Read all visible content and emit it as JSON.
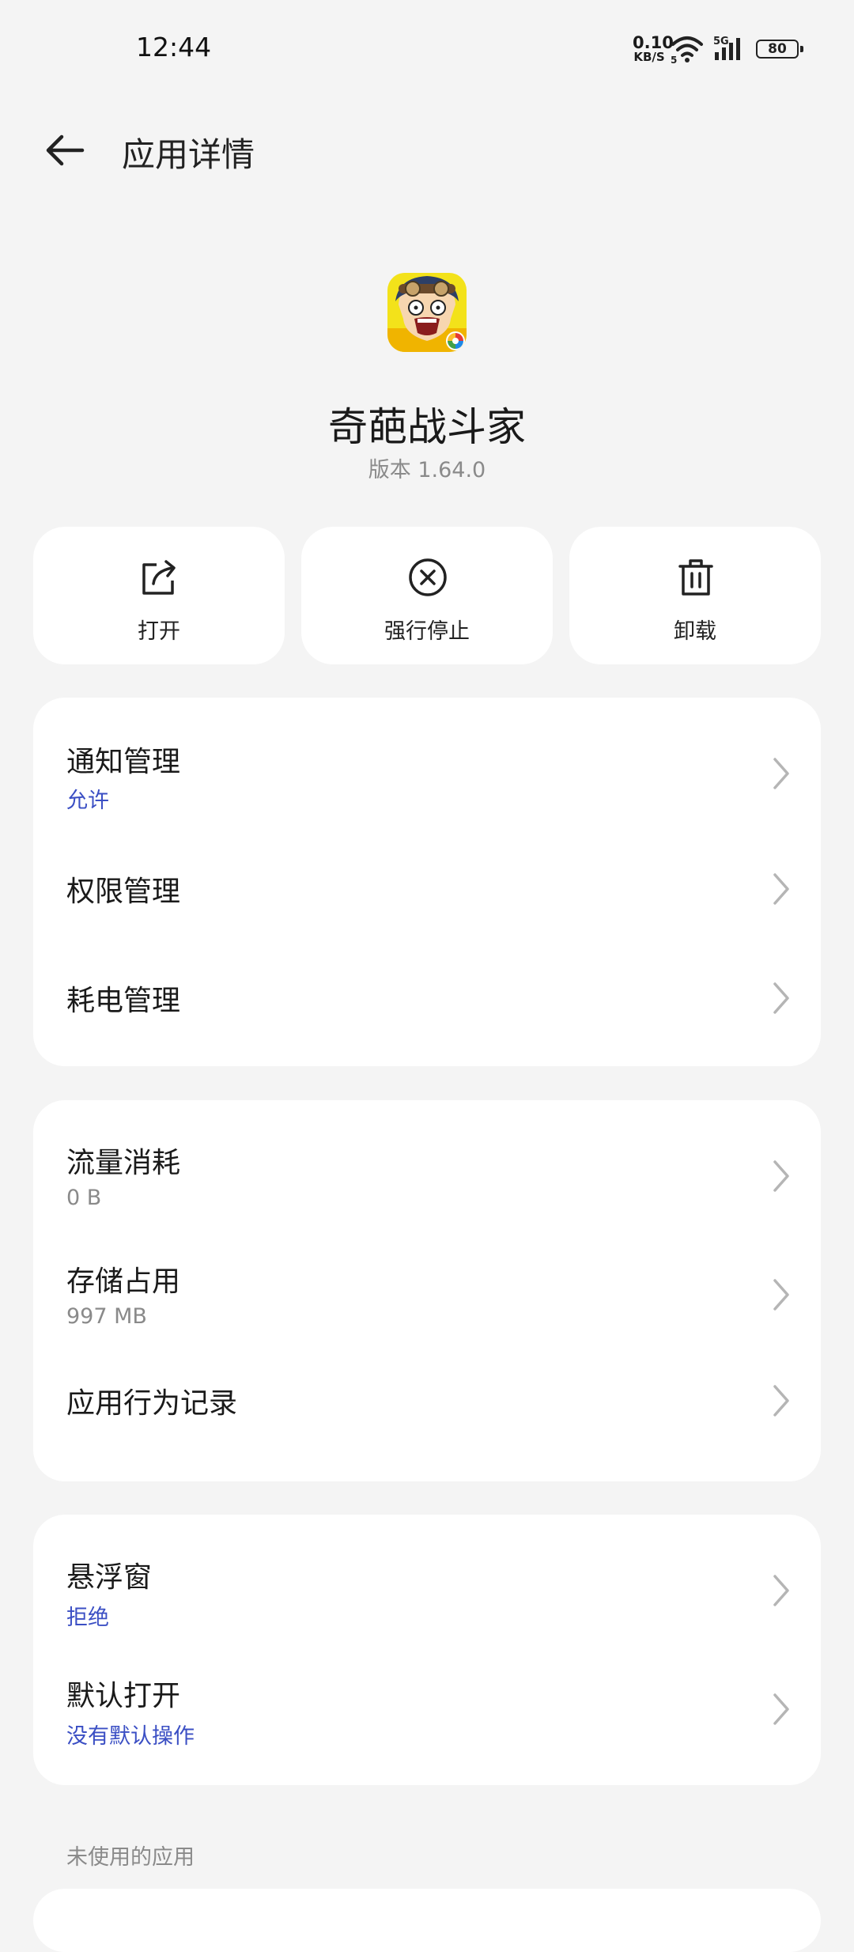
{
  "status_bar": {
    "time": "12:44",
    "net_speed_value": "0.10",
    "net_speed_unit": "KB/S",
    "network_type": "5G",
    "battery": "80"
  },
  "header": {
    "title": "应用详情"
  },
  "app": {
    "name": "奇葩战斗家",
    "version": "版本 1.64.0"
  },
  "actions": [
    {
      "label": "打开",
      "icon": "open-external-icon"
    },
    {
      "label": "强行停止",
      "icon": "force-stop-icon"
    },
    {
      "label": "卸载",
      "icon": "trash-icon"
    }
  ],
  "group1": {
    "items": [
      {
        "title": "通知管理",
        "subtitle": "允许"
      },
      {
        "title": "权限管理"
      },
      {
        "title": "耗电管理"
      }
    ]
  },
  "group2": {
    "items": [
      {
        "title": "流量消耗",
        "subtitle": "0  B"
      },
      {
        "title": "存储占用",
        "subtitle": "997 MB"
      },
      {
        "title": "应用行为记录"
      }
    ]
  },
  "group3": {
    "items": [
      {
        "title": "悬浮窗",
        "subtitle": "拒绝"
      },
      {
        "title": "默认打开",
        "subtitle": "没有默认操作"
      }
    ]
  },
  "unused_section": {
    "label": "未使用的应用"
  },
  "colors": {
    "accent": "#3b4fc4",
    "background": "#f4f4f4",
    "card": "#ffffff"
  }
}
